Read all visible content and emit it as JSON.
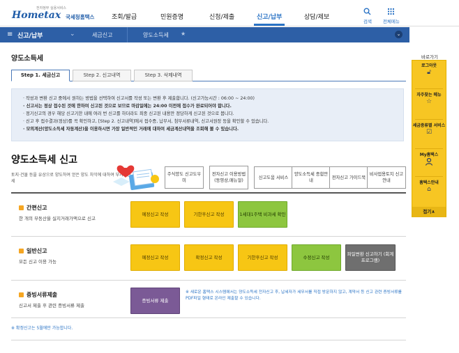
{
  "header": {
    "logo_sub": "전자정부 실용서비스",
    "logo_main": "Hometax",
    "logo_kr": "국세청홈택스",
    "nav": [
      "조회/발급",
      "민원증명",
      "신청/제출",
      "신고/납부",
      "상담/제보"
    ],
    "search_label": "검색",
    "allmenu_label": "전체메뉴"
  },
  "breadcrumb": {
    "level1": "신고/납부",
    "level2": "세금신고",
    "level3": "양도소득세"
  },
  "quick": {
    "title": "바로가기",
    "items": [
      "로그아웃",
      "자주찾는 메뉴",
      "세금종류별 서비스",
      "My홈택스",
      "홈택스안내"
    ],
    "fold": "접기∧"
  },
  "page": {
    "title": "양도소득세",
    "tabs": [
      "Step 1. 세금신고",
      "Step 2. 신고내역",
      "Step 3. 삭제내역"
    ],
    "notices": [
      "· 작성과 변환 신고 중에서 원하는 방법을 선택하여 신고서를 작성 또는 변환 후 제출합니다. (신고가능시간 : 06:00 ~ 24:00)",
      "· 신고서는 정상 접수된 것에 한하여 신고된 것으로 보므로 마감일에는 24:00 이전에 접수가 완료되어야 합니다.",
      "· 정기신고의 경우 해당 신고기한 내에 여러 번 신고를 하더라도 최종 신고된 내용만 정당하게 신고된 것으로 봅니다.",
      "· 신고 후 접수결과(정상)를 꼭 확인하고, [Step 2. 신고내역]에서 접수증, 납부서, 첨부서류내역, 신고서원장 등을 확인할 수 있습니다.",
      "· 모의계산(양도소득세 자동계산)을 이용하시면 가장 일반적인 거래에 대하여 세금계산내역을 조회해 볼 수 있습니다."
    ],
    "section_title": "양도소득세 신고",
    "section_desc": "토지·건물 등을 유상으로 양도하여 얻은 양도 차익에 대하여 부과하는 조세",
    "top_buttons": [
      "주식양도 신고도우미",
      "전자신고 이용방법 (동영상,매뉴얼)",
      "신고도움 서비스",
      "양도소득세 종합안내",
      "전자신고 가이드북",
      "비사업용토지 신고안내"
    ]
  },
  "rows": {
    "simple": {
      "title": "간편신고",
      "desc": "한 개의 부동산을 실지거래가액으로 신고",
      "buttons": [
        "예정신고 작성",
        "기한후신고 작성",
        "1세대1주택 비과세 확인"
      ]
    },
    "general": {
      "title": "일반신고",
      "desc": "모든 신고 이용 가능",
      "buttons": [
        "예정신고 작성",
        "확정신고 작성",
        "기한후신고 작성",
        "수정신고 작성",
        "파일변환 신고하기 (회계 프로그램)"
      ]
    },
    "docs": {
      "title": "증빙서류제출",
      "desc": "신고서 제출 후 관련 증빙서류 제출",
      "button": "증빙서류 제출",
      "note": "※ 새로운 홈택스 시스템에서는 양도소득세 전자신고 후, 납세자가 세무서를 직접 방문하지 않고, 계약서 등 신고 관련 증빙서류를 PDF파일 형태로 온라인 제출할 수 있습니다."
    }
  },
  "footnote": "※ 확정신고는 5월에만 가능합니다.",
  "colors": {
    "brand_blue": "#2d5fa6",
    "accent_yellow": "#f7c614",
    "accent_green": "#8dc63f",
    "accent_purple": "#7b5a96"
  }
}
